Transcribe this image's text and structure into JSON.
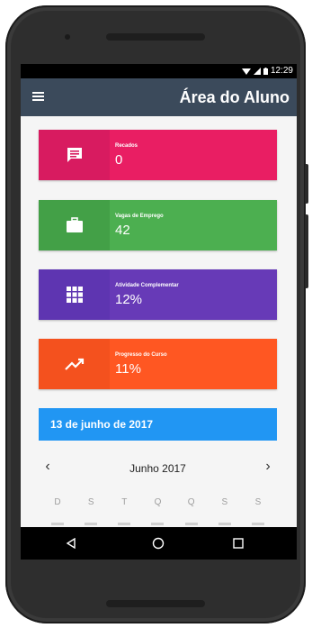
{
  "status": {
    "time": "12:29"
  },
  "appbar": {
    "title": "Área do Aluno"
  },
  "cards": [
    {
      "label": "Recados",
      "value": "0",
      "color": "#e91e63",
      "icon_color": "#d81b60",
      "icon": "message-icon"
    },
    {
      "label": "Vagas de Emprego",
      "value": "42",
      "color": "#4caf50",
      "icon_color": "#43a047",
      "icon": "briefcase-icon"
    },
    {
      "label": "Atividade Complementar",
      "value": "12%",
      "color": "#673ab7",
      "icon_color": "#5e35b1",
      "icon": "grid-icon"
    },
    {
      "label": "Progresso do Curso",
      "value": "11%",
      "color": "#ff5722",
      "icon_color": "#f4511e",
      "icon": "trending-up-icon"
    }
  ],
  "calendar": {
    "selected_date": "13 de junho de 2017",
    "month_label": "Junho 2017",
    "prev": "‹",
    "next": "›",
    "weekdays": [
      "D",
      "S",
      "T",
      "Q",
      "Q",
      "S",
      "S"
    ]
  },
  "colors": {
    "appbar": "#3b4a5b",
    "calendar_header": "#2196f3"
  }
}
